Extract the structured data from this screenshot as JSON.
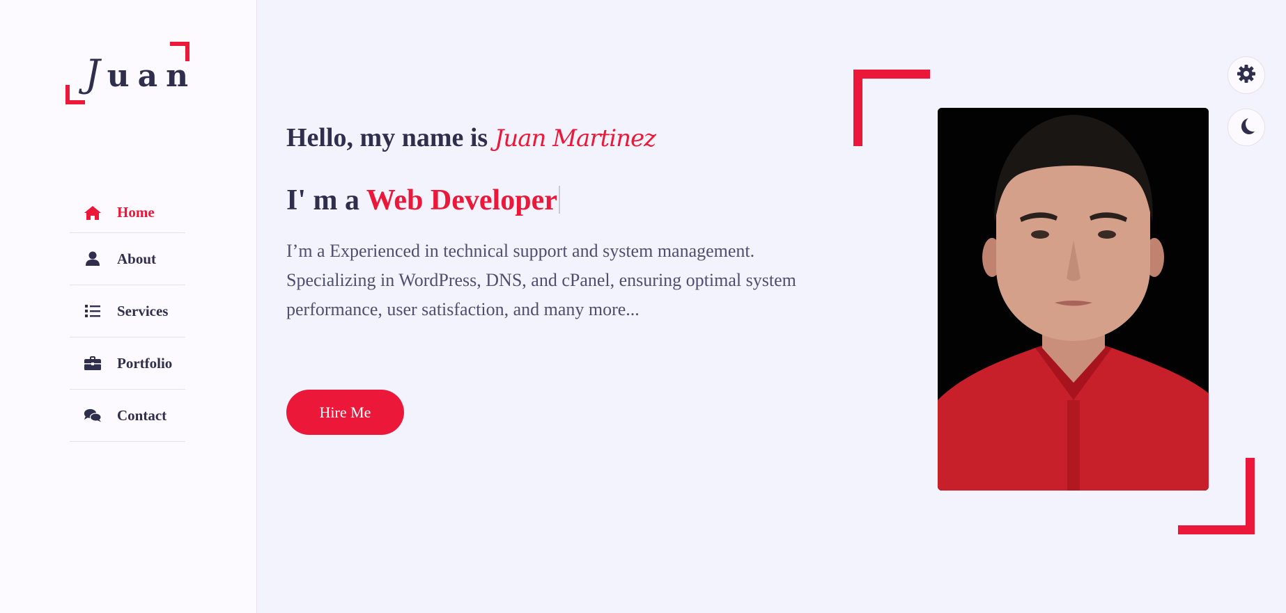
{
  "logo": {
    "first_letter": "J",
    "rest": "uan"
  },
  "nav": {
    "items": [
      {
        "label": "Home",
        "icon": "home-icon",
        "active": true
      },
      {
        "label": "About",
        "icon": "user-icon",
        "active": false
      },
      {
        "label": "Services",
        "icon": "list-icon",
        "active": false
      },
      {
        "label": "Portfolio",
        "icon": "briefcase-icon",
        "active": false
      },
      {
        "label": "Contact",
        "icon": "comments-icon",
        "active": false
      }
    ]
  },
  "hero": {
    "greeting": "Hello, my name is",
    "name": "Juan Martinez",
    "role_prefix": "I' m a",
    "role": "Web Developer",
    "description": "I’m a Experienced in technical support and system management. Specializing in WordPress, DNS, and cPanel, ensuring optimal system performance, user satisfaction, and many more...",
    "hire_label": "Hire Me"
  },
  "photo": {
    "alt": "profile-photo"
  },
  "toggles": {
    "settings_icon": "gear-icon",
    "theme_icon": "moon-icon"
  },
  "colors": {
    "accent": "#ec1839",
    "text": "#302e4d",
    "sidebar_bg": "#fcfaff",
    "main_bg": "#f2f3fc"
  }
}
